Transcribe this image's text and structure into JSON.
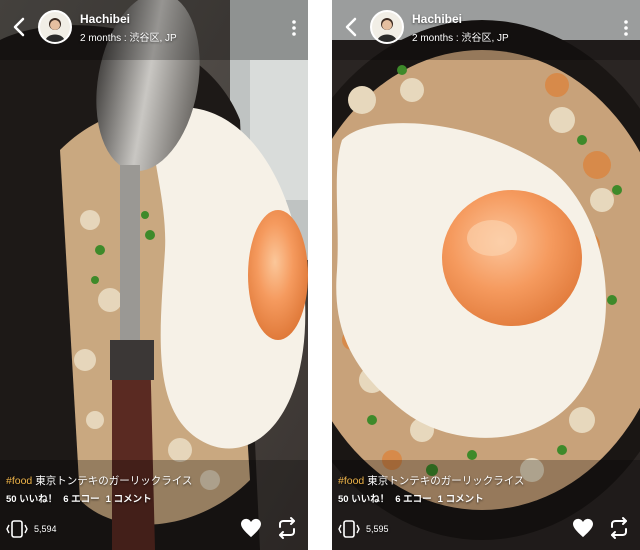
{
  "screens": [
    {
      "username": "Hachibei",
      "time": "2 months",
      "location": "渋谷区, JP",
      "hashtag": "#food",
      "caption": " 東京トンテキのガーリックライス",
      "likes": "50 いいね！",
      "echoes": "6 エコー",
      "comments": "1 コメント",
      "views": "5,594"
    },
    {
      "username": "Hachibei",
      "time": "2 months",
      "location": "渋谷区, JP",
      "hashtag": "#food",
      "caption": " 東京トンテキのガーリックライス",
      "likes": "50 いいね！",
      "echoes": "6 エコー",
      "comments": "1 コメント",
      "views": "5,595"
    }
  ],
  "icons": {
    "back": "chevron-left-icon",
    "more": "more-vertical-icon",
    "views": "phone-views-icon",
    "like": "heart-icon",
    "echo": "repost-arrows-icon"
  },
  "colors": {
    "hashtag": "#f0b54a",
    "egg_yolk": "#f08a4f",
    "egg_white": "#f6f1e7",
    "pan": "#1a1614"
  }
}
